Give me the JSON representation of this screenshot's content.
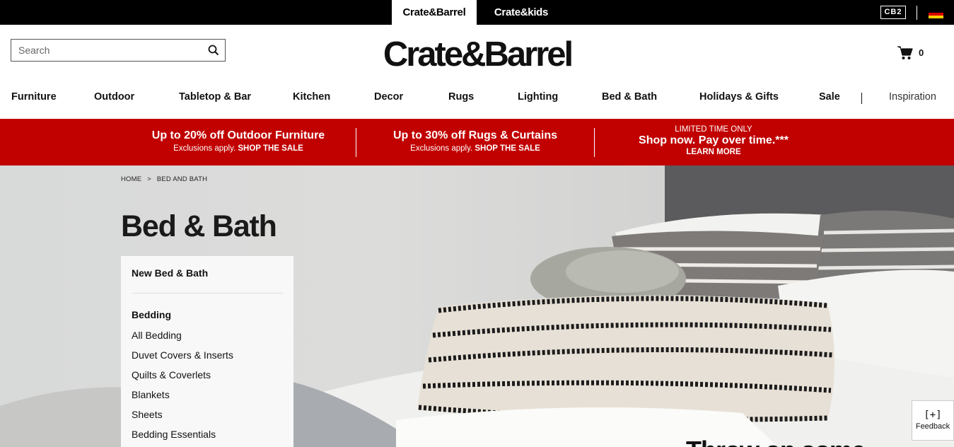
{
  "topbar": {
    "brand_active": "Crate&Barrel",
    "brand_kids": "Crate&kids",
    "cb2": "CB2"
  },
  "header": {
    "search_placeholder": "Search",
    "logo": "Crate&Barrel",
    "cart_count": "0"
  },
  "nav": {
    "items": [
      "Furniture",
      "Outdoor",
      "Tabletop & Bar",
      "Kitchen",
      "Decor",
      "Rugs",
      "Lighting",
      "Bed & Bath",
      "Holidays & Gifts",
      "Sale"
    ],
    "inspiration": "Inspiration"
  },
  "promo": {
    "col1": {
      "title": "Up to 20% off Outdoor Furniture",
      "note": "Exclusions apply.",
      "cta": "SHOP THE SALE"
    },
    "col2": {
      "title": "Up to 30% off Rugs & Curtains",
      "note": "Exclusions apply.",
      "cta": "SHOP THE SALE"
    },
    "col3": {
      "kicker": "LIMITED TIME ONLY",
      "title": "Shop now. Pay over time.***",
      "cta": "LEARN MORE"
    }
  },
  "breadcrumb": {
    "home": "HOME",
    "sep": ">",
    "current": "BED AND BATH"
  },
  "page_title": "Bed & Bath",
  "sidebar": {
    "new_item": "New Bed & Bath",
    "section": "Bedding",
    "links": [
      "All Bedding",
      "Duvet Covers & Inserts",
      "Quilts & Coverlets",
      "Blankets",
      "Sheets",
      "Bedding Essentials"
    ]
  },
  "hero_teaser": "Throw on some",
  "feedback": {
    "icon": "[+]",
    "label": "Feedback"
  },
  "colors": {
    "promo_red": "#c10000",
    "topbar_black": "#000000"
  }
}
